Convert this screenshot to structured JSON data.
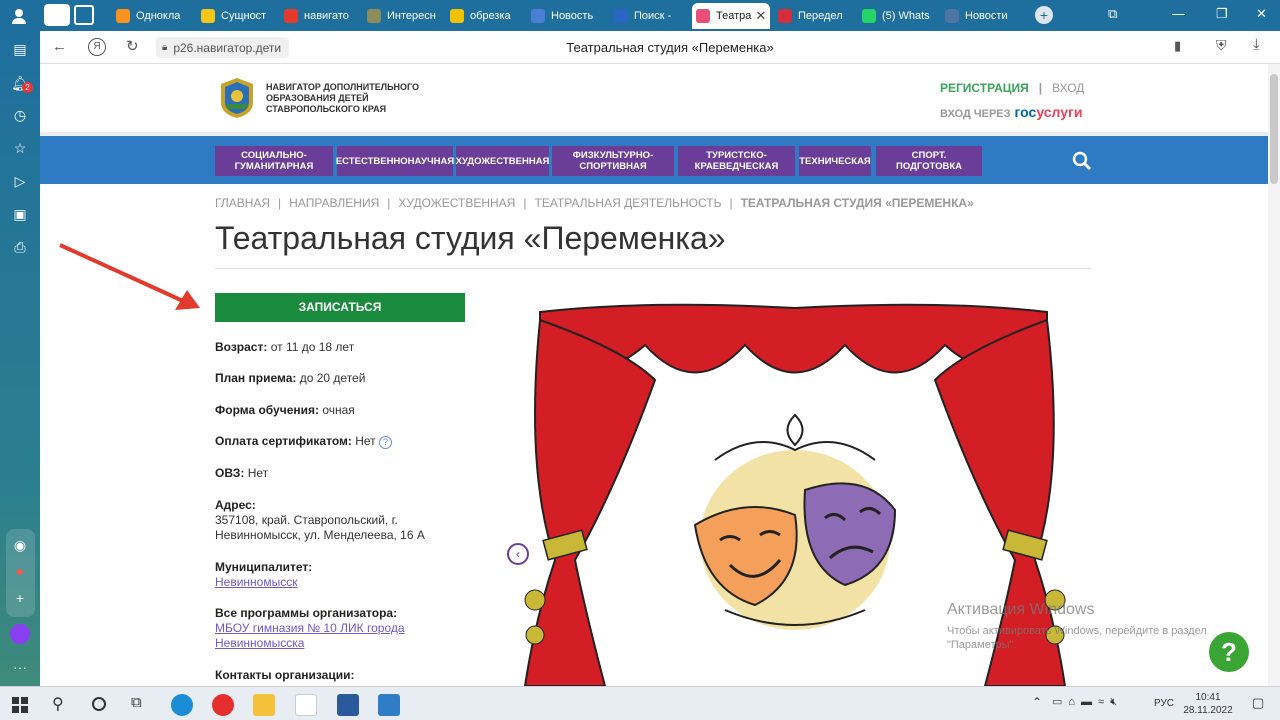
{
  "browser": {
    "tabs": [
      {
        "label": "Однокла",
        "color": "#f7931e"
      },
      {
        "label": "Сущност",
        "color": "#f5c518"
      },
      {
        "label": "навигато",
        "color": "#e23b2e"
      },
      {
        "label": "Интересн",
        "color": "#8c8c5a"
      },
      {
        "label": "обрезка",
        "color": "#f2c200"
      },
      {
        "label": "Новость",
        "color": "#4a7fd4"
      },
      {
        "label": "Поиск -",
        "color": "#2a64c5"
      },
      {
        "label": "Театра",
        "color": "#e94e77"
      },
      {
        "label": "Передел",
        "color": "#d22e3e"
      },
      {
        "label": "(5) Whats",
        "color": "#25d366"
      },
      {
        "label": "Новости",
        "color": "#4c75a3"
      }
    ],
    "url": "р26.навигатор.дети",
    "page_title": "Театральная студия «Переменка»",
    "notification_count": "2"
  },
  "header": {
    "logo_text_1": "НАВИГАТОР ДОПОЛНИТЕЛЬНОГО",
    "logo_text_2": "ОБРАЗОВАНИЯ ДЕТЕЙ",
    "logo_text_3": "СТАВРОПОЛЬСКОГО КРАЯ",
    "register": "РЕГИСТРАЦИЯ",
    "divider": "|",
    "login": "ВХОД",
    "login_via": "ВХОД ЧЕРЕЗ",
    "gos": "гос",
    "uslugi": "услуги"
  },
  "menu": [
    "СОЦИАЛЬНО-ГУМАНИТАРНАЯ",
    "ЕСТЕСТВЕННОНАУЧНАЯ",
    "ХУДОЖЕСТВЕННАЯ",
    "ФИЗКУЛЬТУРНО-СПОРТИВНАЯ",
    "ТУРИСТСКО-КРАЕВЕДЧЕСКАЯ",
    "ТЕХНИЧЕСКАЯ",
    "СПОРТ. ПОДГОТОВКА"
  ],
  "breadcrumb": {
    "items": [
      "ГЛАВНАЯ",
      "НАПРАВЛЕНИЯ",
      "ХУДОЖЕСТВЕННАЯ",
      "ТЕАТРАЛЬНАЯ ДЕЯТЕЛЬНОСТЬ"
    ],
    "current": "ТЕАТРАЛЬНАЯ СТУДИЯ «ПЕРЕМЕНКА»",
    "sep": "|"
  },
  "title": "Театральная студия «Переменка»",
  "enroll_button": "ЗАПИСАТЬСЯ",
  "info": {
    "age_label": "Возраст:",
    "age_value": "от 11 до 18 лет",
    "plan_label": "План приема:",
    "plan_value": "до 20 детей",
    "form_label": "Форма обучения:",
    "form_value": "очная",
    "cert_label": "Оплата сертификатом:",
    "cert_value": "Нет",
    "help": "?",
    "ovz_label": "ОВЗ:",
    "ovz_value": "Нет",
    "address_label": "Адрес:",
    "address_line1": "357108, край. Ставропольский, г.",
    "address_line2": "Невинномысск, ул. Менделеева, 16 А",
    "muni_label": "Муниципалитет:",
    "muni_value": "Невинномысск",
    "programs_label": "Все программы организатора:",
    "programs_line1": "МБОУ гимназия № 10 ЛИК города",
    "programs_line2": "Невинномысска",
    "contacts_label": "Контакты организации:"
  },
  "watermark": {
    "title": "Активация Windows",
    "line1": "Чтобы активировать Windows, перейдите в раздел",
    "line2": "\"Параметры\"."
  },
  "help_bubble": "?",
  "taskbar": {
    "lang": "РУС",
    "time": "10:41",
    "date": "28.11.2022"
  },
  "colors": {
    "tabbar": "#1f6f9e",
    "nav_blue": "#2e7bc4",
    "menu_purple": "#6a3e98",
    "enroll_green": "#1a8a3c",
    "register_green": "#3aa35a",
    "curtain_red": "#d21e24"
  }
}
